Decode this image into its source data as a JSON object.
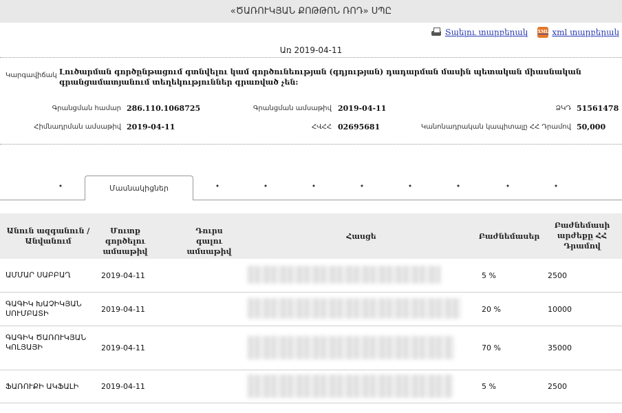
{
  "header": {
    "title": "«ԾԱՌՈՒԿՅԱՆ ՔՈԹԹՈՆ ՌՈԴ» ՍՊԸ"
  },
  "actions": {
    "print_label": "Տպելու տարբերակ",
    "xml_label": "xml տարբերակ",
    "xml_icon_text": "XML"
  },
  "as_of": "Առ 2019-04-11",
  "status": {
    "label": "Կարգավիճակ",
    "text": "Լուծարման գործընթացում գտնվելու կամ գործունեության (գդյության) դադարման մասին պետական միասնական գրանցամատյանում տեղեկություններ գրառված չեն:"
  },
  "details": {
    "reg_number_label": "Գրանցման համար",
    "reg_number": "286.110.1068725",
    "reg_date_label": "Գրանցման ամսաթիվ",
    "reg_date": "2019-04-11",
    "tin_label": "ՀՎՀՀ",
    "tin": "02695681",
    "founding_date_label": "Հիմնադրման ամսաթիվ",
    "founding_date": "2019-04-11",
    "code_label": "ՁԿԴ",
    "code": "51561478",
    "capital_label": "Կանոնադրական կապիտալը ՀՀ Դրամով",
    "capital": "50,000"
  },
  "tabs": {
    "active": "Մասնակիցներ",
    "dots": [
      "•",
      "•",
      "•",
      "•",
      "•",
      "•",
      "•",
      "•",
      "•",
      "•"
    ]
  },
  "table": {
    "headers": [
      "Անուն ազգանուն / Անվանում",
      "Մուտք գործելու ամսաթիվ",
      "Դուրս գալու ամսաթիվ",
      "Հասցե",
      "Բաժնեմասեր",
      "Բաժնեմասի արժեքը ՀՀ Դրամով"
    ],
    "rows": [
      {
        "name": "ԱՄՄԱՐ ՍԱԲԲԱՂ",
        "entry": "2019-04-11",
        "exit": "",
        "share": "5 %",
        "value": "2500"
      },
      {
        "name": "ԳԱԳԻԿ ԽԱՉԻԿՅԱՆ ՍՈՒՄԲԱՏԻ",
        "entry": "2019-04-11",
        "exit": "",
        "share": "20 %",
        "value": "10000"
      },
      {
        "name": "ԳԱԳԻԿ ԾԱՌՈՒԿՅԱՆ ԿՈԼՅԱՅԻ",
        "entry": "2019-04-11",
        "exit": "",
        "share": "70 %",
        "value": "35000"
      },
      {
        "name": "ՖԱՌՈՒՔԻ ԱԿՖԱԼԻ",
        "entry": "2019-04-11",
        "exit": "",
        "share": "5 %",
        "value": "2500"
      }
    ]
  }
}
